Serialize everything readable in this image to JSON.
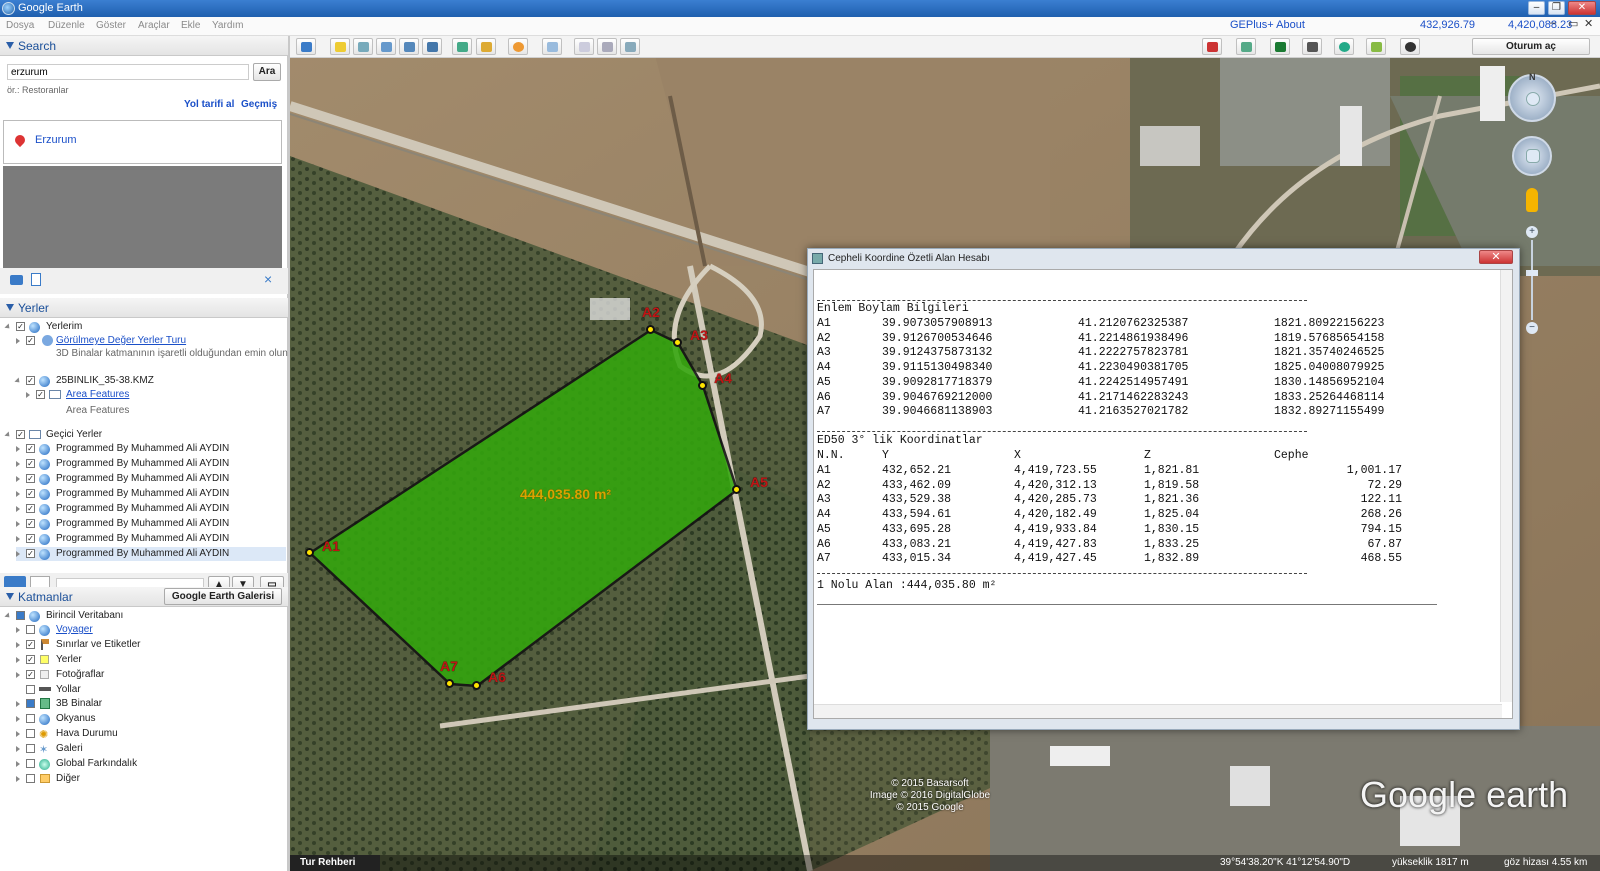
{
  "window": {
    "title": "Google Earth"
  },
  "menu": {
    "items": [
      "Dosya",
      "Düzenle",
      "Göster",
      "Araçlar",
      "Ekle",
      "Yardım"
    ],
    "geplus": "GEPlus+ About",
    "coord_x": "432,926.79",
    "coord_y": "4,420,088.23"
  },
  "search": {
    "header": "Search",
    "input_value": "erzurum",
    "button": "Ara",
    "hint": "ör.: Restoranlar",
    "route_link": "Yol tarifi al",
    "history_link": "Geçmiş",
    "result": "Erzurum"
  },
  "places": {
    "header": "Yerler",
    "myplaces": "Yerlerim",
    "tour": "Görülmeye Değer Yerler Turu",
    "tour_note": "3D Binalar katmanının işaretli olduğundan emin olun",
    "kmz": "25BINLIK_35-38.KMZ",
    "area_features": "Area Features",
    "area_features_sub": "Area Features",
    "temp": "Geçici Yerler",
    "programmed": [
      "Programmed By Muhammed Ali AYDIN",
      "Programmed By Muhammed Ali AYDIN",
      "Programmed By Muhammed Ali AYDIN",
      "Programmed By Muhammed Ali AYDIN",
      "Programmed By Muhammed Ali AYDIN",
      "Programmed By Muhammed Ali AYDIN",
      "Programmed By Muhammed Ali AYDIN",
      "Programmed By Muhammed Ali AYDIN"
    ]
  },
  "layers": {
    "header": "Katmanlar",
    "gallery_button": "Google Earth Galerisi",
    "db": "Birincil Veritabanı",
    "items": [
      "Voyager",
      "Sınırlar ve Etiketler",
      "Yerler",
      "Fotoğraflar",
      "Yollar",
      "3B Binalar",
      "Okyanus",
      "Hava Durumu",
      "Galeri",
      "Global Farkındalık",
      "Diğer"
    ]
  },
  "toolbar": {
    "login": "Oturum aç"
  },
  "map": {
    "area_label": "444,035.80 m²",
    "vertex_labels": [
      "A1",
      "A2",
      "A3",
      "A4",
      "A5",
      "A6",
      "A7"
    ],
    "copyright": [
      "© 2015 Basarsoft",
      "Image © 2016 DigitalGlobe",
      "© 2015 Google"
    ],
    "logo": "Google earth",
    "tour_guide": "Tur Rehberi",
    "status": {
      "coords": "39°54'38.20\"K   41°12'54.90\"D",
      "elev": "yükseklik  1817 m",
      "eye": "göz hizası    4.55 km"
    }
  },
  "dialog": {
    "title": "Cepheli Koordine Özetli Alan Hesabı",
    "close": "✕",
    "latlon_header": "Enlem Boylam Bilgileri",
    "latlon": [
      [
        "A1",
        "39.9073057908913",
        "41.2120762325387",
        "1821.80922156223"
      ],
      [
        "A2",
        "39.9126700534646",
        "41.2214861938496",
        "1819.57685654158"
      ],
      [
        "A3",
        "39.9124375873132",
        "41.2222757823781",
        "1821.35740246525"
      ],
      [
        "A4",
        "39.9115130498340",
        "41.2230490381705",
        "1825.04008079925"
      ],
      [
        "A5",
        "39.9092817718379",
        "41.2242514957491",
        "1830.14856952104"
      ],
      [
        "A6",
        "39.9046769212000",
        "41.2171462283243",
        "1833.25264468114"
      ],
      [
        "A7",
        "39.9046681138903",
        "41.2163527021782",
        "1832.89271155499"
      ]
    ],
    "ed50_header": "ED50 3° lik Koordinatlar",
    "ed50_cols": [
      "N.N.",
      "Y",
      "X",
      "Z",
      "Cephe"
    ],
    "ed50": [
      [
        "A1",
        "432,652.21",
        "4,419,723.55",
        "1,821.81",
        "1,001.17"
      ],
      [
        "A2",
        "433,462.09",
        "4,420,312.13",
        "1,819.58",
        "72.29"
      ],
      [
        "A3",
        "433,529.38",
        "4,420,285.73",
        "1,821.36",
        "122.11"
      ],
      [
        "A4",
        "433,594.61",
        "4,420,182.49",
        "1,825.04",
        "268.26"
      ],
      [
        "A5",
        "433,695.28",
        "4,419,933.84",
        "1,830.15",
        "794.15"
      ],
      [
        "A6",
        "433,083.21",
        "4,419,427.83",
        "1,833.25",
        "67.87"
      ],
      [
        "A7",
        "433,015.34",
        "4,419,427.45",
        "1,832.89",
        "468.55"
      ]
    ],
    "summary": "1 Nolu Alan :444,035.80 m²"
  }
}
